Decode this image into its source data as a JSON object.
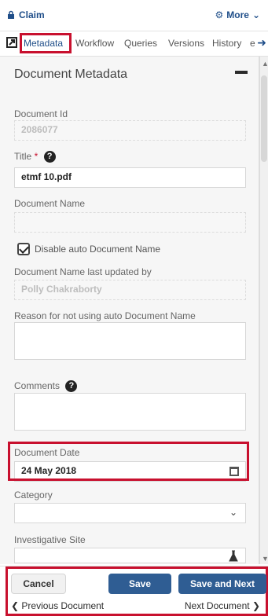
{
  "header": {
    "claim_label": "Claim",
    "more_label": "More"
  },
  "tabs": [
    {
      "label": "Metadata",
      "active": true
    },
    {
      "label": "Workflow",
      "active": false
    },
    {
      "label": "Queries",
      "active": false
    },
    {
      "label": "Versions",
      "active": false
    },
    {
      "label": "History",
      "active": false
    },
    {
      "label": "e",
      "active": false
    }
  ],
  "section": {
    "title": "Document Metadata"
  },
  "fields": {
    "document_id_label": "Document Id",
    "document_id_value": "2086077",
    "title_label": "Title",
    "title_value": "etmf 10.pdf",
    "document_name_label": "Document Name",
    "document_name_value": "",
    "disable_auto_label": "Disable auto Document Name",
    "last_updated_label": "Document Name last updated by",
    "last_updated_value": "Polly Chakraborty",
    "reason_label": "Reason for not using auto Document Name",
    "reason_value": "",
    "comments_label": "Comments",
    "comments_value": "",
    "document_date_label": "Document Date",
    "document_date_value": "24 May 2018",
    "category_label": "Category",
    "category_value": "",
    "investigative_site_label": "Investigative Site",
    "investigative_site_value": ""
  },
  "footer": {
    "cancel_label": "Cancel",
    "save_label": "Save",
    "save_next_label": "Save and Next",
    "previous_label": "Previous Document",
    "next_label": "Next Document"
  },
  "colors": {
    "accent": "#2f5d93",
    "highlight": "#c8102e"
  }
}
